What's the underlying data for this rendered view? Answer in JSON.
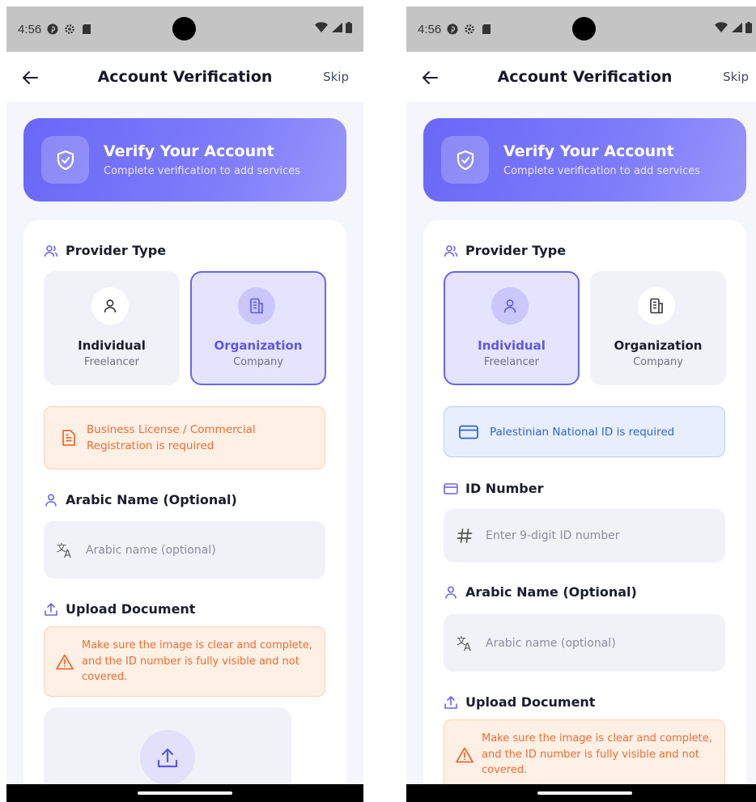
{
  "screens": [
    {
      "status_time": "4:56",
      "header": {
        "title": "Account Verification",
        "skip_label": "Skip"
      },
      "hero": {
        "title": "Verify Your Account",
        "subtitle": "Complete verification to add services"
      },
      "provider_type": {
        "label": "Provider Type",
        "selected": "organization",
        "options": [
          {
            "title": "Individual",
            "subtitle": "Freelancer"
          },
          {
            "title": "Organization",
            "subtitle": "Company"
          }
        ]
      },
      "requirement_notice": "Business License / Commercial Registration is required",
      "arabic_name": {
        "label": "Arabic Name (Optional)",
        "placeholder": "Arabic name (optional)"
      },
      "upload": {
        "label": "Upload Document",
        "warning": "Make sure the image is clear and complete, and the ID number is fully visible and not covered."
      }
    },
    {
      "status_time": "4:56",
      "header": {
        "title": "Account Verification",
        "skip_label": "Skip"
      },
      "hero": {
        "title": "Verify Your Account",
        "subtitle": "Complete verification to add services"
      },
      "provider_type": {
        "label": "Provider Type",
        "selected": "individual",
        "options": [
          {
            "title": "Individual",
            "subtitle": "Freelancer"
          },
          {
            "title": "Organization",
            "subtitle": "Company"
          }
        ]
      },
      "requirement_notice": "Palestinian National ID is required",
      "id_number": {
        "label": "ID Number",
        "placeholder": "Enter 9-digit ID number"
      },
      "arabic_name": {
        "label": "Arabic Name (Optional)",
        "placeholder": "Arabic name (optional)"
      },
      "upload": {
        "label": "Upload Document",
        "warning": "Make sure the image is clear and complete, and the ID number is fully visible and not covered."
      }
    }
  ],
  "colors": {
    "accent": "#6c63f0",
    "hero_gradient_start": "#6a67f7",
    "hero_gradient_end": "#9896fb",
    "warning_text": "#f26b2f",
    "warning_bg": "#fff0e6",
    "info_text": "#3062d6",
    "info_bg": "#e7efff"
  },
  "icons": {
    "status": [
      "pinterest-icon",
      "gear-icon",
      "sd-card-icon",
      "wifi-icon",
      "signal-icon",
      "battery-icon"
    ],
    "header_back": "arrow-left-icon",
    "hero": "shield-check-icon",
    "provider_type": "users-icon",
    "individual": "user-icon",
    "organization": "building-icon",
    "license_notice": "document-icon",
    "id_notice": "id-card-icon",
    "id_number": "id-card-icon",
    "id_input": "hash-icon",
    "arabic_name": "user-icon",
    "arabic_input": "translate-icon",
    "upload": "upload-icon",
    "warning": "warning-triangle-icon"
  }
}
